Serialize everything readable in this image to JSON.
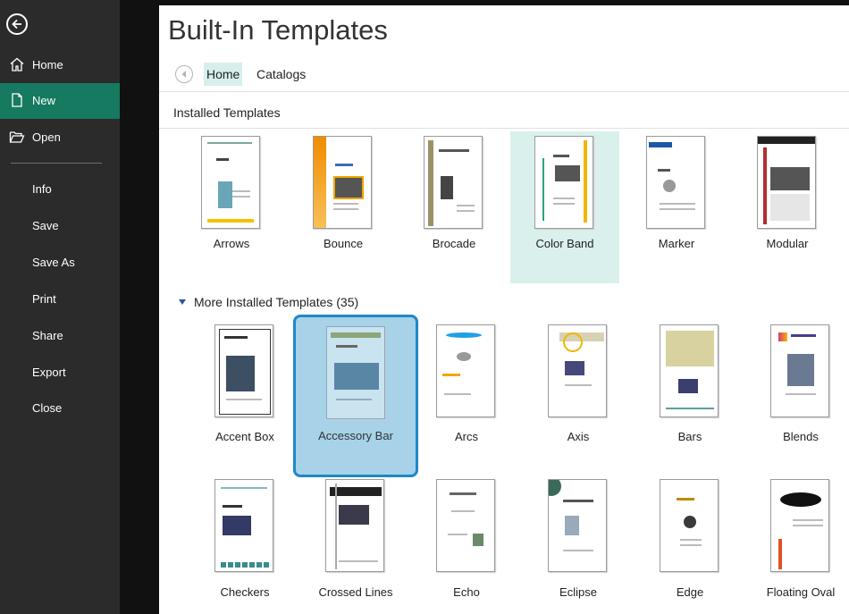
{
  "sidebar": {
    "items": [
      {
        "label": "Home",
        "icon": "home-icon"
      },
      {
        "label": "New",
        "icon": "new-document-icon",
        "active": true
      },
      {
        "label": "Open",
        "icon": "open-folder-icon"
      },
      {
        "label": "Info"
      },
      {
        "label": "Save"
      },
      {
        "label": "Save As"
      },
      {
        "label": "Print"
      },
      {
        "label": "Share"
      },
      {
        "label": "Export"
      },
      {
        "label": "Close"
      }
    ],
    "active_color": "#157a5f"
  },
  "page": {
    "title": "Built-In Templates",
    "breadcrumb": {
      "home": "Home",
      "catalogs": "Catalogs"
    }
  },
  "installed": {
    "title": "Installed Templates",
    "templates": [
      "Arrows",
      "Bounce",
      "Brocade",
      "Color Band",
      "Marker",
      "Modular"
    ],
    "highlighted": "Color Band"
  },
  "more": {
    "title": "More Installed Templates (35)",
    "row1": [
      "Accent Box",
      "Accessory Bar",
      "Arcs",
      "Axis",
      "Bars",
      "Blends"
    ],
    "row2": [
      "Checkers",
      "Crossed Lines",
      "Echo",
      "Eclipse",
      "Edge",
      "Floating Oval"
    ],
    "selected": "Accessory Bar"
  }
}
